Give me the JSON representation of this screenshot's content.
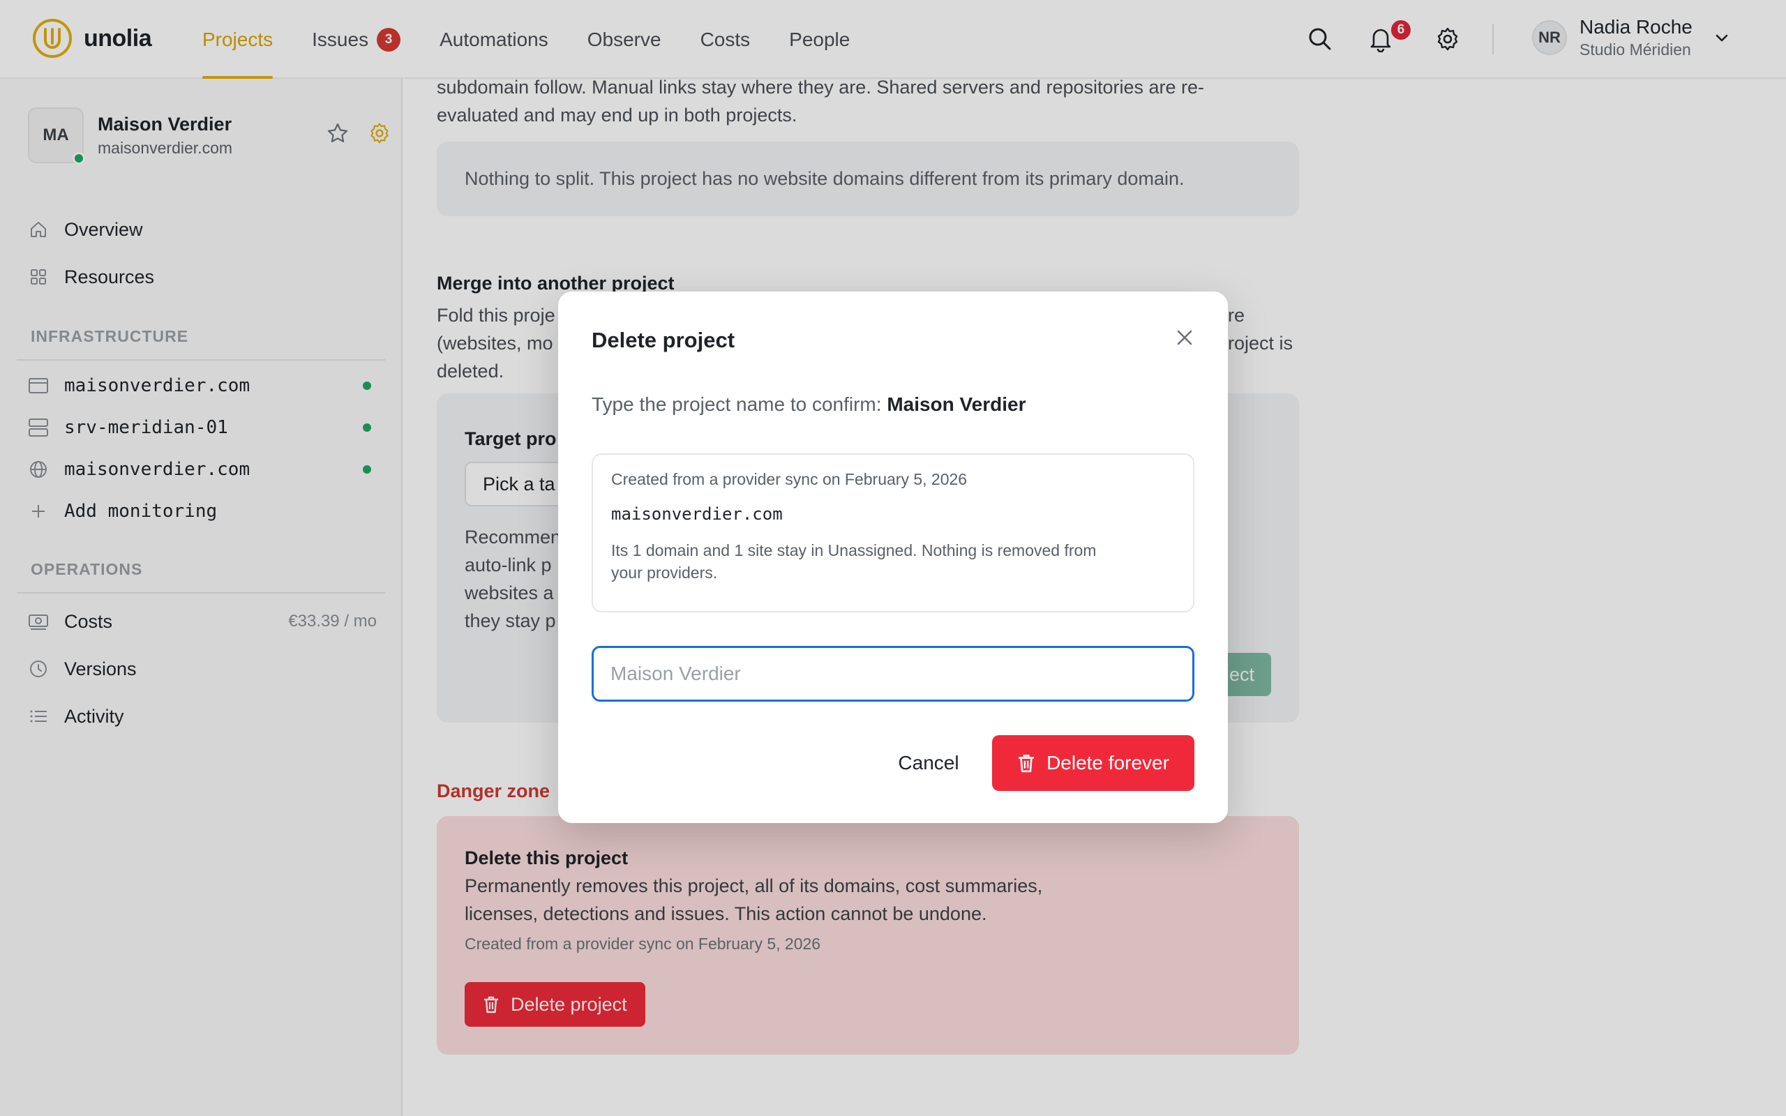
{
  "brand": {
    "name": "unolia",
    "accent": "#e0ae10"
  },
  "nav": [
    {
      "label": "Projects",
      "active": true
    },
    {
      "label": "Issues",
      "badge": "3"
    },
    {
      "label": "Automations"
    },
    {
      "label": "Observe"
    },
    {
      "label": "Costs"
    },
    {
      "label": "People"
    }
  ],
  "topbar": {
    "notifications_count": "6",
    "icons": [
      "search-icon",
      "bell-icon",
      "gear-icon",
      "chevron-down-icon"
    ]
  },
  "user": {
    "initials": "NR",
    "name": "Nadia Roche",
    "org": "Studio Méridien"
  },
  "project": {
    "initials": "MA",
    "name": "Maison Verdier",
    "domain": "maisonverdier.com"
  },
  "sidebar": {
    "main": [
      {
        "label": "Overview",
        "icon": "home-icon"
      },
      {
        "label": "Resources",
        "icon": "grid-icon"
      }
    ],
    "infrastructure_title": "INFRASTRUCTURE",
    "infrastructure": [
      {
        "label": "maisonverdier.com",
        "icon": "browser-icon"
      },
      {
        "label": "srv-meridian-01",
        "icon": "server-icon"
      },
      {
        "label": "maisonverdier.com",
        "icon": "globe-icon"
      },
      {
        "label": "Add monitoring",
        "icon": "plus-icon"
      }
    ],
    "operations_title": "OPERATIONS",
    "operations": [
      {
        "label": "Costs",
        "icon": "money-icon",
        "value": "€33.39 / mo"
      },
      {
        "label": "Versions",
        "icon": "clock-icon"
      },
      {
        "label": "Activity",
        "icon": "list-icon"
      }
    ]
  },
  "main": {
    "split_text_1": "subdomain follow. Manual links stay where they are. Shared servers and repositories are re-",
    "split_text_2": "evaluated and may end up in both projects.",
    "split_notice": "Nothing to split. This project has no website domains different from its primary domain.",
    "merge_title": "Merge into another project",
    "merge_text_1": "Fold this proje",
    "merge_text_1b": "re",
    "merge_text_2": "(websites, mo",
    "merge_text_2b": "roject is",
    "merge_text_3": "deleted.",
    "merge_target_label": "Target pro",
    "merge_pick": "Pick a ta",
    "merge_rec_1": "Recommen",
    "merge_rec_2": "auto-link p",
    "merge_rec_3": "websites a",
    "merge_rec_4": "they stay p",
    "merge_button_fragment": "ect",
    "danger_title": "Danger zone",
    "danger_heading": "Delete this project",
    "danger_text_1": "Permanently removes this project, all of its domains, cost summaries,",
    "danger_text_2": "licenses, detections and issues. This action cannot be undone.",
    "danger_meta": "Created from a provider sync on February 5, 2026",
    "danger_button": "Delete project"
  },
  "modal": {
    "title": "Delete project",
    "confirm_prefix": "Type the project name to confirm:",
    "confirm_name": "Maison Verdier",
    "info_created": "Created from a provider sync on February 5, 2026",
    "info_domain": "maisonverdier.com",
    "info_note_1": "Its 1 domain and 1 site stay in Unassigned. Nothing is removed from",
    "info_note_2": "your providers.",
    "input_placeholder": "Maison Verdier",
    "input_value": "",
    "cancel": "Cancel",
    "delete": "Delete forever",
    "danger_color": "#f0293a"
  }
}
